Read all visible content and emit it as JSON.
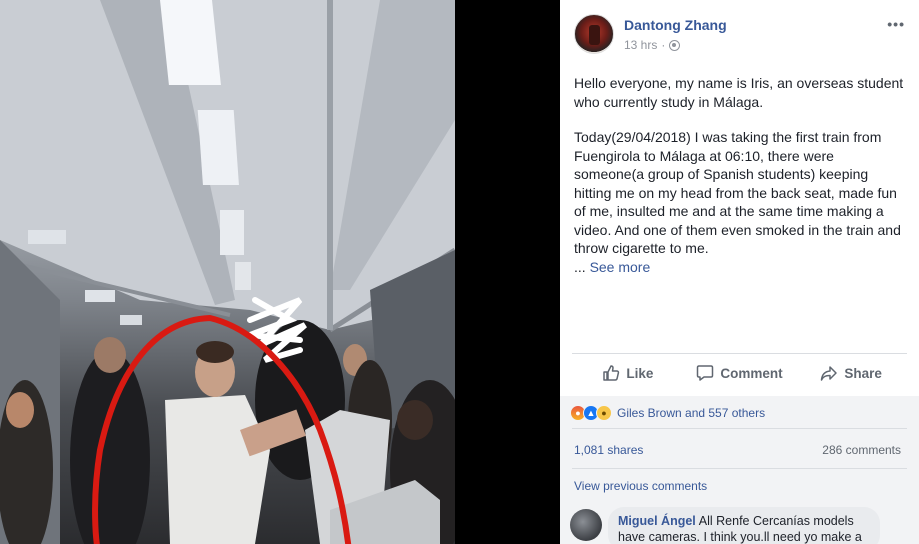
{
  "post": {
    "author": "Dantong Zhang",
    "time": "13 hrs",
    "paragraph1": "Hello everyone, my name is Iris, an overseas student who currently study in Málaga.",
    "paragraph2": "Today(29/04/2018) I was taking the first train from Fuengirola to Málaga at 06:10, there were someone(a group of Spanish students) keeping hitting me on my head from the back seat, made fun of me, insulted me and at the same time making a video. And one of them even smoked in the train and throw cigarette to me.",
    "ellipsis": "... ",
    "see_more": "See more"
  },
  "actions": {
    "like": "Like",
    "comment": "Comment",
    "share": "Share"
  },
  "reactions": {
    "names": "Giles Brown and 557 others",
    "icons": [
      "angry-reaction-icon",
      "like-reaction-icon",
      "sad-reaction-icon"
    ]
  },
  "stats": {
    "shares": "1,081 shares",
    "comments": "286 comments"
  },
  "view_previous": "View previous comments",
  "comment": {
    "author": "Miguel Ángel",
    "text": "All Renfe Cercanías models have cameras. I think you.ll need yo make a"
  },
  "colors": {
    "link": "#385898",
    "muted": "#90949c",
    "annotation": "#d91a12"
  }
}
